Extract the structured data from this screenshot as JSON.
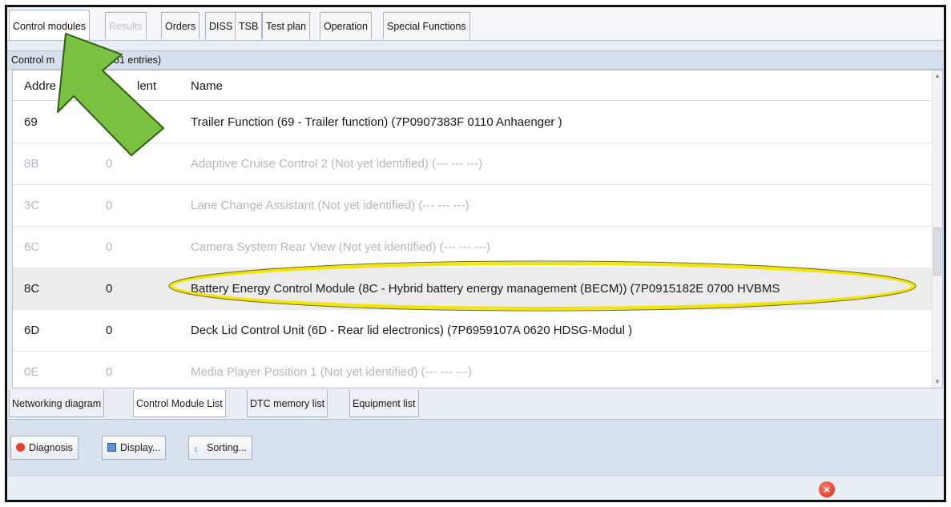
{
  "top_tabs": [
    {
      "label": "Control modules",
      "state": "active"
    },
    {
      "label": "Results",
      "state": "disabled"
    },
    {
      "label": "Orders",
      "state": "normal"
    },
    {
      "label": "DISS",
      "state": "normal"
    },
    {
      "label": "TSB",
      "state": "normal"
    },
    {
      "label": "Test plan",
      "state": "normal"
    },
    {
      "label": "Operation",
      "state": "normal"
    },
    {
      "label": "Special Functions",
      "state": "normal"
    }
  ],
  "group_header": {
    "label": "Control m",
    "count_label": "51 entries)"
  },
  "table": {
    "headers": {
      "address": "Addre",
      "ident": "lent",
      "name": "Name"
    },
    "rows": [
      {
        "address": "69",
        "ident": "",
        "name": "Trailer Function (69 - Trailer function) (7P0907383F   0110  Anhaenger   )",
        "style": "normal"
      },
      {
        "address": "8B",
        "ident": "0",
        "name": "Adaptive Cruise Control 2 (Not yet identified) (---  ---  ---)",
        "style": "dim"
      },
      {
        "address": "3C",
        "ident": "0",
        "name": "Lane Change Assistant (Not yet identified) (---  ---  ---)",
        "style": "dim"
      },
      {
        "address": "6C",
        "ident": "0",
        "name": "Camera System Rear View (Not yet identified) (---  ---  ---)",
        "style": "dim"
      },
      {
        "address": "8C",
        "ident": "0",
        "name": "Battery Energy Control Module (8C - Hybrid battery energy management (BECM)) (7P0915182E   0700  HVBMS",
        "style": "selected"
      },
      {
        "address": "6D",
        "ident": "0",
        "name": "Deck Lid Control Unit (6D - Rear lid electronics) (7P6959107A   0620  HDSG-Modul  )",
        "style": "normal"
      },
      {
        "address": "0E",
        "ident": "0",
        "name": "Media Player Position 1 (Not yet identified) (---  ---  ---)",
        "style": "dim"
      }
    ]
  },
  "bottom_tabs": [
    {
      "label": "Networking diagram",
      "state": "normal"
    },
    {
      "label": "Control Module List",
      "state": "active"
    },
    {
      "label": "DTC memory list",
      "state": "normal"
    },
    {
      "label": "Equipment list",
      "state": "normal"
    }
  ],
  "toolbar": {
    "diagnosis_label": "Diagnosis",
    "display_label": "Display...",
    "sorting_label": "Sorting..."
  },
  "colors": {
    "arrow_fill": "#7cc242",
    "arrow_stroke": "#2e5e12",
    "highlight_ellipse": "#f2e600",
    "accent_red": "#e0432e"
  },
  "icons": {
    "annotation_arrow": "arrow-icon",
    "diagnosis": "red-dot-icon",
    "display": "display-icon",
    "sorting": "sort-icon",
    "close": "close-icon"
  }
}
